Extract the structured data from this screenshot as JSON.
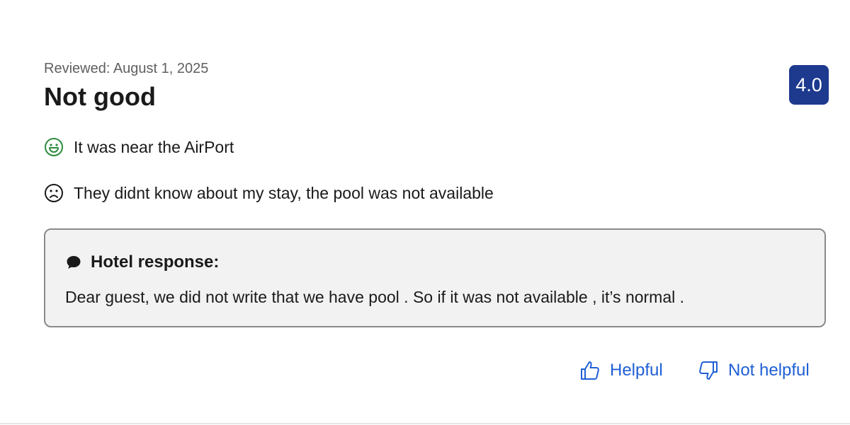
{
  "review": {
    "date_label": "Reviewed: August 1, 2025",
    "title": "Not good",
    "score": "4.0",
    "pro": {
      "icon": "smile-icon",
      "text": "It was near the AirPort"
    },
    "con": {
      "icon": "frown-icon",
      "text": "They didnt know about my stay, the pool was not available"
    }
  },
  "hotel_response": {
    "icon": "speech-bubble-icon",
    "header": "Hotel response:",
    "text": "Dear guest, we did not write that we have pool . So if it was not available , it’s normal ."
  },
  "votes": {
    "helpful_label": "Helpful",
    "helpful_icon": "thumbs-up-icon",
    "not_helpful_label": "Not helpful",
    "not_helpful_icon": "thumbs-down-icon"
  },
  "colors": {
    "badge": "#1d3a8f",
    "link": "#1f5fd6",
    "positive": "#2e8b3e",
    "response_bg": "#f2f2f2"
  }
}
